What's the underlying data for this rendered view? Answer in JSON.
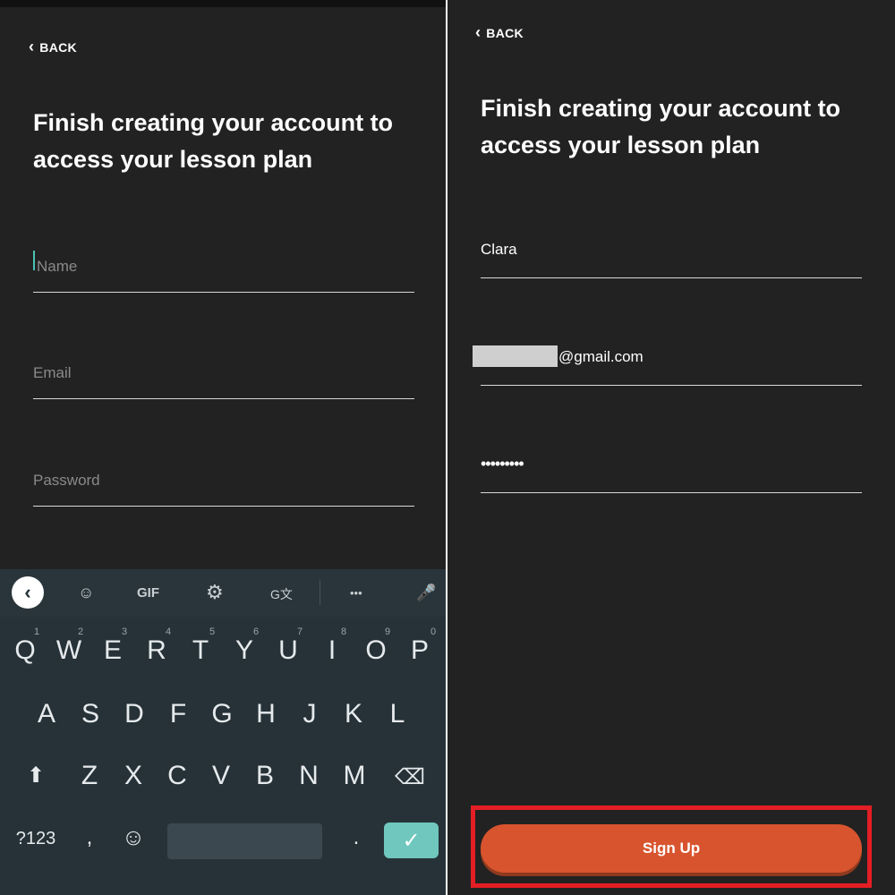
{
  "left": {
    "back_label": "BACK",
    "title": "Finish creating your account to access your lesson plan",
    "name_placeholder": "Name",
    "email_placeholder": "Email",
    "password_placeholder": "Password"
  },
  "keyboard": {
    "toolbar": {
      "collapse": "‹",
      "sticker": "☺",
      "gif": "GIF",
      "settings": "⚙",
      "translate": "G文",
      "more": "•••",
      "mic": "🎤"
    },
    "row1": [
      "Q",
      "W",
      "E",
      "R",
      "T",
      "Y",
      "U",
      "I",
      "O",
      "P"
    ],
    "row1_hints": [
      "1",
      "2",
      "3",
      "4",
      "5",
      "6",
      "7",
      "8",
      "9",
      "0"
    ],
    "row2": [
      "A",
      "S",
      "D",
      "F",
      "G",
      "H",
      "J",
      "K",
      "L"
    ],
    "row3": [
      "Z",
      "X",
      "C",
      "V",
      "B",
      "N",
      "M"
    ],
    "shift": "⬆",
    "backspace": "⌫",
    "symbols": "?123",
    "comma": ",",
    "emoji": "☺",
    "period": ".",
    "enter": "✓"
  },
  "right": {
    "back_label": "BACK",
    "title": "Finish creating your account to access your lesson plan",
    "name_value": "Clara",
    "email_value": "@gmail.com",
    "password_value": "•••••••••",
    "signup_label": "Sign Up"
  },
  "colors": {
    "background": "#222222",
    "accent_caret": "#49c3b5",
    "signup_button": "#d8542e",
    "highlight_outline": "#e31e24",
    "keyboard_bg": "#263238"
  }
}
